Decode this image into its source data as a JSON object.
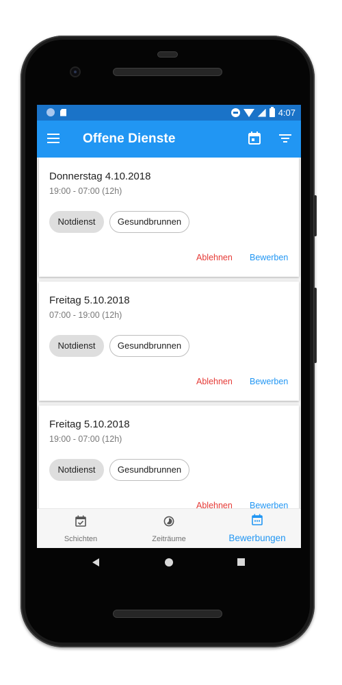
{
  "status_bar": {
    "time": "4:07"
  },
  "app_bar": {
    "title": "Offene Dienste",
    "menu_icon": "hamburger-menu-icon",
    "calendar_icon": "calendar-today-icon",
    "filter_icon": "filter-list-icon"
  },
  "shifts": [
    {
      "date": "Donnerstag 4.10.2018",
      "time": "19:00 - 07:00 (12h)",
      "type_chip": "Notdienst",
      "location_chip": "Gesundbrunnen",
      "reject_label": "Ablehnen",
      "apply_label": "Bewerben"
    },
    {
      "date": "Freitag 5.10.2018",
      "time": "07:00 - 19:00 (12h)",
      "type_chip": "Notdienst",
      "location_chip": "Gesundbrunnen",
      "reject_label": "Ablehnen",
      "apply_label": "Bewerben"
    },
    {
      "date": "Freitag 5.10.2018",
      "time": "19:00 - 07:00 (12h)",
      "type_chip": "Notdienst",
      "location_chip": "Gesundbrunnen",
      "reject_label": "Ablehnen",
      "apply_label": "Bewerben"
    }
  ],
  "bottom_nav": {
    "items": [
      {
        "label": "Schichten",
        "icon": "calendar-check-icon",
        "active": false
      },
      {
        "label": "Zeiträume",
        "icon": "timelapse-icon",
        "active": false
      },
      {
        "label": "Bewerbungen",
        "icon": "calendar-dots-icon",
        "active": true
      }
    ]
  },
  "colors": {
    "status_bar": "#1a73c8",
    "app_bar": "#2196f3",
    "accent": "#2196f3",
    "reject": "#e53935"
  }
}
